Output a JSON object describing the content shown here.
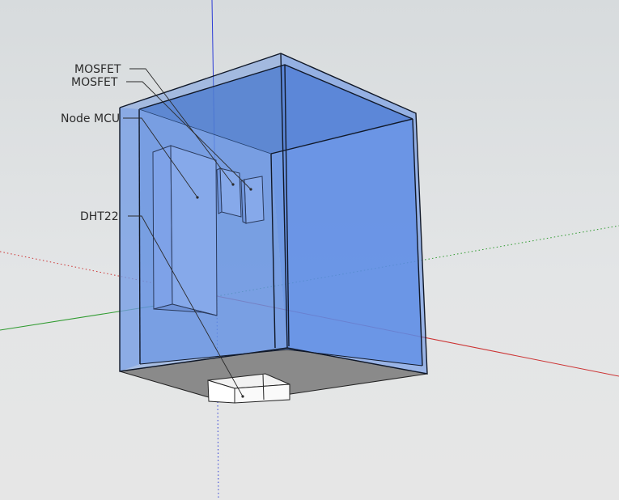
{
  "scene": {
    "annotations": {
      "mosfet_1": "MOSFET",
      "mosfet_2": "MOSFET",
      "node_mcu": "Node MCU",
      "dht22": "DHT22"
    },
    "colors": {
      "background": "#dcdfe1",
      "enclosure_glass": "#5b8de6",
      "enclosure_edge": "#101828",
      "floor": "#8a8a8a",
      "sensor_body": "#ffffff",
      "axis_red": "#cc3333",
      "axis_green": "#2e9a2e",
      "axis_blue": "#2b3bd6"
    }
  }
}
